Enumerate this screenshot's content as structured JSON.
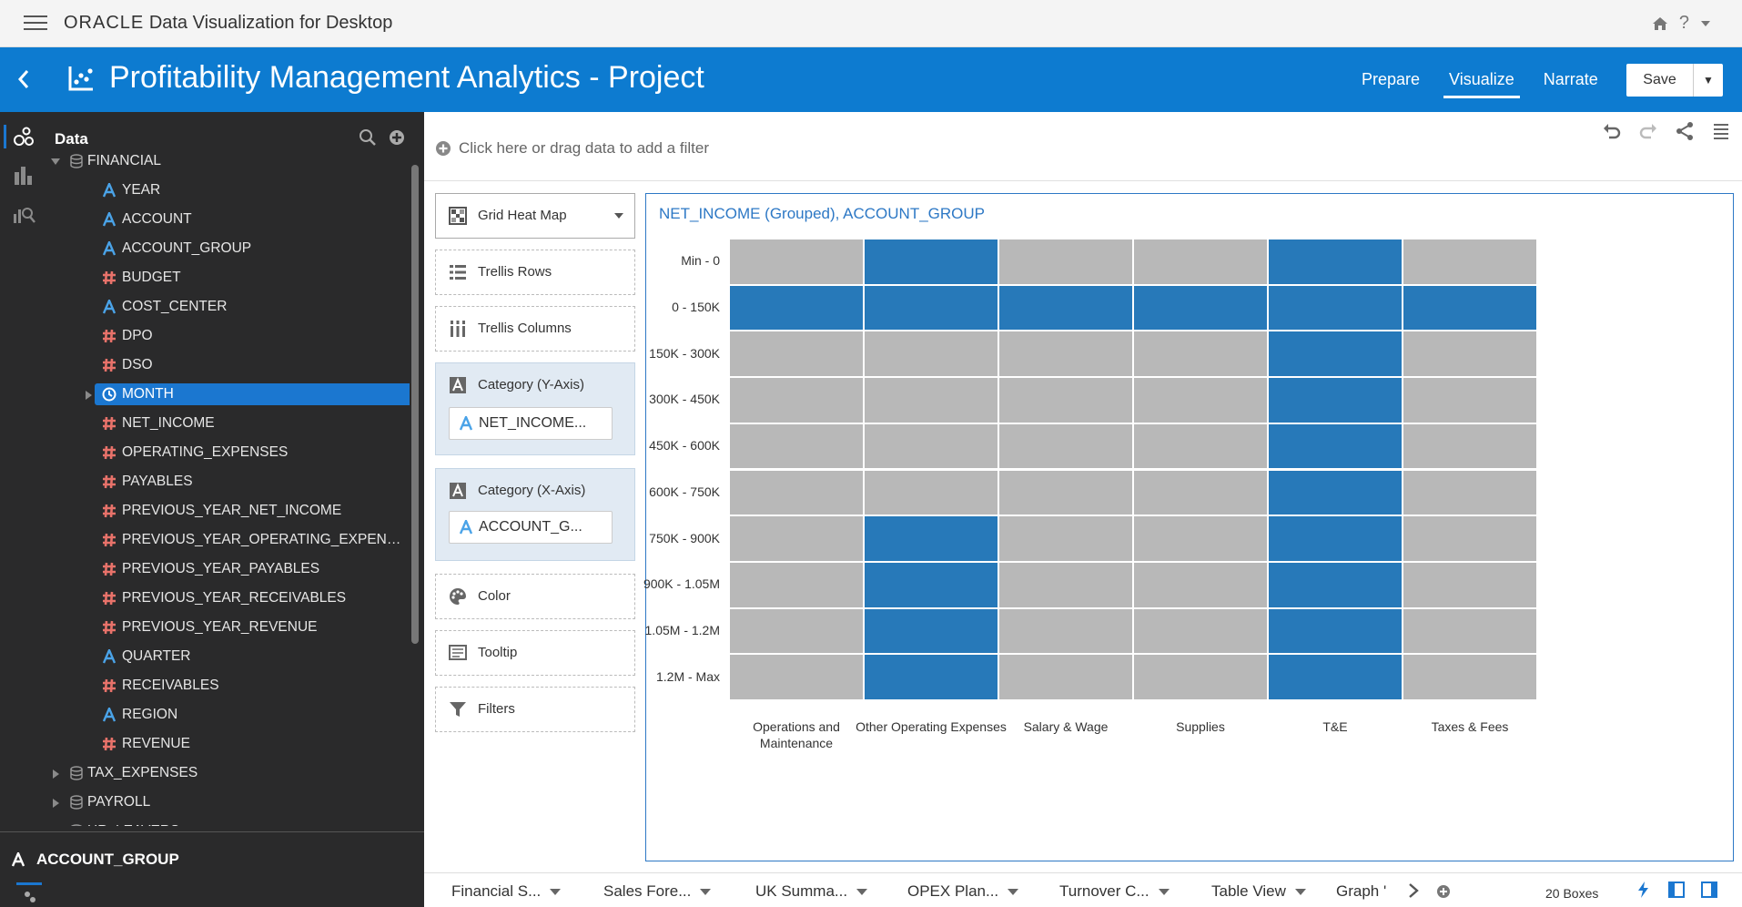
{
  "topbar": {
    "brand_oracle": "ORACLE",
    "brand_rest": "Data Visualization for Desktop",
    "help": "?"
  },
  "project": {
    "title": "Profitability Management Analytics - Project",
    "tabs": [
      {
        "label": "Prepare"
      },
      {
        "label": "Visualize"
      },
      {
        "label": "Narrate"
      }
    ],
    "active_tab": "Visualize",
    "save_label": "Save"
  },
  "datapanel": {
    "header": "Data",
    "tree": [
      {
        "label": "FINANCIAL",
        "type": "dataset",
        "level": 0,
        "expanded": true
      },
      {
        "label": "YEAR",
        "type": "attribute",
        "level": 1
      },
      {
        "label": "ACCOUNT",
        "type": "attribute",
        "level": 1
      },
      {
        "label": "ACCOUNT_GROUP",
        "type": "attribute",
        "level": 1
      },
      {
        "label": "BUDGET",
        "type": "measure",
        "level": 1
      },
      {
        "label": "COST_CENTER",
        "type": "attribute",
        "level": 1
      },
      {
        "label": "DPO",
        "type": "measure",
        "level": 1
      },
      {
        "label": "DSO",
        "type": "measure",
        "level": 1
      },
      {
        "label": "MONTH",
        "type": "time",
        "level": 1,
        "selected": true,
        "expandable": true
      },
      {
        "label": "NET_INCOME",
        "type": "measure",
        "level": 1
      },
      {
        "label": "OPERATING_EXPENSES",
        "type": "measure",
        "level": 1
      },
      {
        "label": "PAYABLES",
        "type": "measure",
        "level": 1
      },
      {
        "label": "PREVIOUS_YEAR_NET_INCOME",
        "type": "measure",
        "level": 1
      },
      {
        "label": "PREVIOUS_YEAR_OPERATING_EXPEN…",
        "type": "measure",
        "level": 1
      },
      {
        "label": "PREVIOUS_YEAR_PAYABLES",
        "type": "measure",
        "level": 1
      },
      {
        "label": "PREVIOUS_YEAR_RECEIVABLES",
        "type": "measure",
        "level": 1
      },
      {
        "label": "PREVIOUS_YEAR_REVENUE",
        "type": "measure",
        "level": 1
      },
      {
        "label": "QUARTER",
        "type": "attribute",
        "level": 1
      },
      {
        "label": "RECEIVABLES",
        "type": "measure",
        "level": 1
      },
      {
        "label": "REGION",
        "type": "attribute",
        "level": 1
      },
      {
        "label": "REVENUE",
        "type": "measure",
        "level": 1
      },
      {
        "label": "TAX_EXPENSES",
        "type": "dataset",
        "level": 0,
        "expanded": false
      },
      {
        "label": "PAYROLL",
        "type": "dataset",
        "level": 0,
        "expanded": false
      },
      {
        "label": "HR_LEAVERS",
        "type": "dataset",
        "level": 0,
        "expanded": false
      }
    ],
    "selected_element": "ACCOUNT_GROUP"
  },
  "filterbar": {
    "placeholder": "Click here or drag data to add a filter"
  },
  "grammar": {
    "viz_type": "Grid Heat Map",
    "trellis_rows": "Trellis Rows",
    "trellis_columns": "Trellis Columns",
    "category_y": "Category (Y-Axis)",
    "category_y_pill": "NET_INCOME...",
    "category_x": "Category (X-Axis)",
    "category_x_pill": "ACCOUNT_G...",
    "color": "Color",
    "tooltip": "Tooltip",
    "filters": "Filters"
  },
  "colors": {
    "brand_blue": "#0d7bd0",
    "cell_on": "#2779b9",
    "cell_off": "#b8b8b8",
    "panel_dark": "#2a2a2b",
    "measure_red": "#e8726a",
    "attribute_blue": "#4aa3e8"
  },
  "chart_data": {
    "type": "heatmap",
    "title": "NET_INCOME (Grouped), ACCOUNT_GROUP",
    "x_categories": [
      "Operations and Maintenance",
      "Other Operating Expenses",
      "Salary & Wage",
      "Supplies",
      "T&E",
      "Taxes & Fees"
    ],
    "y_categories": [
      "Min - 0",
      "0 - 150K",
      "150K - 300K",
      "300K - 450K",
      "450K - 600K",
      "600K - 750K",
      "750K - 900K",
      "900K - 1.05M",
      "1.05M - 1.2M",
      "1.2M - Max"
    ],
    "filled": [
      [
        0,
        1,
        0,
        0,
        1,
        0
      ],
      [
        1,
        1,
        1,
        1,
        1,
        1
      ],
      [
        0,
        0,
        0,
        0,
        1,
        0
      ],
      [
        0,
        0,
        0,
        0,
        1,
        0
      ],
      [
        0,
        0,
        0,
        0,
        1,
        0
      ],
      [
        0,
        0,
        0,
        0,
        1,
        0
      ],
      [
        0,
        1,
        0,
        0,
        1,
        0
      ],
      [
        0,
        1,
        0,
        0,
        1,
        0
      ],
      [
        0,
        1,
        0,
        0,
        1,
        0
      ],
      [
        0,
        1,
        0,
        0,
        1,
        0
      ]
    ]
  },
  "bottombar": {
    "canvases": [
      "Financial S...",
      "Sales Fore...",
      "UK Summa...",
      "OPEX Plan...",
      "Turnover C...",
      "Table View",
      "Graph '"
    ],
    "status": "20 Boxes"
  }
}
